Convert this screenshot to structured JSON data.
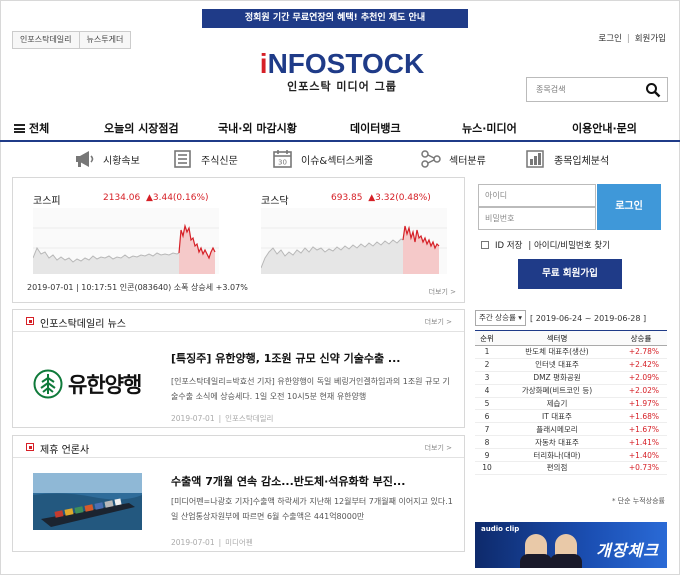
{
  "banner": "정회원 기간 무료연장의 혜택! 추천인 제도 안내",
  "site_tabs": [
    "인포스탁데일리",
    "뉴스투게더"
  ],
  "top_links": {
    "login": "로그인",
    "join": "회원가입"
  },
  "logo": {
    "main_i": "i",
    "main_rest": "NFOSTOCK",
    "sub": "인포스탁 미디어 그룹"
  },
  "search": {
    "placeholder": "종목검색"
  },
  "main_nav": [
    "전체",
    "오늘의 시장점검",
    "국내·외 마감시황",
    "데이터뱅크",
    "뉴스·미디어",
    "이용안내·문의"
  ],
  "sub_nav": [
    {
      "label": "시황속보",
      "icon": "megaphone-icon"
    },
    {
      "label": "주식신문",
      "icon": "newspaper-icon"
    },
    {
      "label": "이슈&섹터스케줄",
      "icon": "calendar-icon"
    },
    {
      "label": "섹터분류",
      "icon": "network-icon"
    },
    {
      "label": "종목입체분석",
      "icon": "bar-chart-icon"
    }
  ],
  "market": {
    "kospi": {
      "name": "코스피",
      "value": "2134.06",
      "change": "▲3.44(0.16%)"
    },
    "kosdaq": {
      "name": "코스닥",
      "value": "693.85",
      "change": "▲3.32(0.48%)"
    },
    "footer": "2019-07-01 | 10:17:51        인콘(083640) 소폭 상승세 +3.07%",
    "more": "더보기 >"
  },
  "login": {
    "id_placeholder": "아이디",
    "pw_placeholder": "비밀번호",
    "button": "로그인",
    "save_id": "ID 저장",
    "find": "| 아이디/비밀번호 찾기",
    "join_button": "무료 회원가입"
  },
  "news_daily": {
    "title": "인포스탁데일리 뉴스",
    "more": "더보기 >",
    "thumb_text": "유한양행",
    "headline": "[특징주] 유한양행, 1조원 규모 신약 기술수출 ...",
    "summary": "[인포스탁데일리=박효선 기자] 유한양행이 독일 베링거인겔하임과의 1조원 규모 기술수출 소식에 상승세다. 1일 오전 10시5분 현재 유한양행",
    "date": "2019-07-01",
    "source": "인포스탁데일리"
  },
  "news_partner": {
    "title": "제휴 언론사",
    "more": "더보기 >",
    "headline": "수출액 7개월 연속 감소...반도체·석유화학 부진...",
    "summary": "[미디어펜=나광호 기자]수출액 하락세가 지난해 12월부터 7개월째 이어지고 있다.1일 산업통상자원부에 따르면 6월 수출액은 441억8000만",
    "date": "2019-07-01",
    "source": "미디어펜"
  },
  "ranking": {
    "select": "주간 상승률 ▾",
    "period": "[ 2019-06-24 ~ 2019-06-28 ]",
    "headers": [
      "순위",
      "섹터명",
      "상승률"
    ],
    "rows": [
      [
        "1",
        "반도체 대표주(생산)",
        "+2.78%"
      ],
      [
        "2",
        "인터넷 대표주",
        "+2.42%"
      ],
      [
        "3",
        "DMZ 평화공원",
        "+2.09%"
      ],
      [
        "4",
        "가상화폐(비트코인 등)",
        "+2.02%"
      ],
      [
        "5",
        "제습기",
        "+1.97%"
      ],
      [
        "6",
        "IT 대표주",
        "+1.68%"
      ],
      [
        "7",
        "플래시메모리",
        "+1.67%"
      ],
      [
        "8",
        "자동차 대표주",
        "+1.41%"
      ],
      [
        "9",
        "터리화나(대마)",
        "+1.40%"
      ],
      [
        "10",
        "편의점",
        "+0.73%"
      ]
    ],
    "note": "* 단순 누적상승률"
  },
  "ad": {
    "logo": "audio clip",
    "text": "개장체크"
  },
  "colors": {
    "navy": "#1f3b88",
    "red": "#d62027",
    "login_blue": "#3f98d9"
  }
}
